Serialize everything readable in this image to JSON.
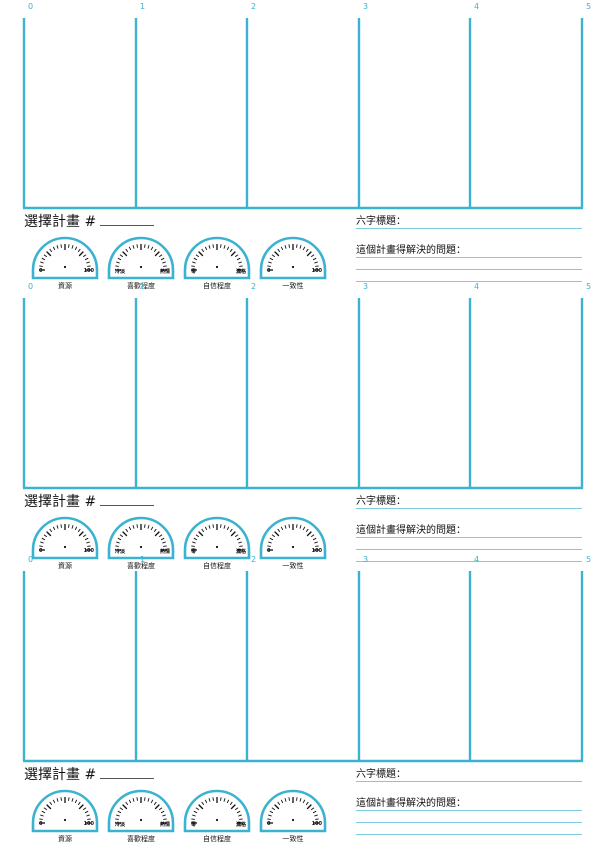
{
  "accent_color": "#3bb3d0",
  "axis_ticks": [
    "0",
    "1",
    "2",
    "3",
    "4",
    "5"
  ],
  "icons": {
    "gauge": "gauge-icon"
  },
  "blocks": [
    {
      "selection_label": "選擇計畫 #",
      "six_char_title_label": "六字標題：",
      "problem_label": "這個計畫得解決的問題：",
      "gauges": [
        {
          "caption": "資源",
          "low": "0",
          "high": "100"
        },
        {
          "caption": "喜歡程度",
          "low": "冷淡",
          "high": "熱情"
        },
        {
          "caption": "自信程度",
          "low": "零",
          "high": "滿格"
        },
        {
          "caption": "一致性",
          "low": "0",
          "high": "100"
        }
      ]
    },
    {
      "selection_label": "選擇計畫 #",
      "six_char_title_label": "六字標題：",
      "problem_label": "這個計畫得解決的問題：",
      "gauges": [
        {
          "caption": "資源",
          "low": "0",
          "high": "100"
        },
        {
          "caption": "喜歡程度",
          "low": "冷淡",
          "high": "熱情"
        },
        {
          "caption": "自信程度",
          "low": "零",
          "high": "滿格"
        },
        {
          "caption": "一致性",
          "low": "0",
          "high": "100"
        }
      ]
    },
    {
      "selection_label": "選擇計畫 #",
      "six_char_title_label": "六字標題：",
      "problem_label": "這個計畫得解決的問題：",
      "gauges": [
        {
          "caption": "資源",
          "low": "0",
          "high": "100"
        },
        {
          "caption": "喜歡程度",
          "low": "冷淡",
          "high": "熱情"
        },
        {
          "caption": "自信程度",
          "low": "零",
          "high": "滿格"
        },
        {
          "caption": "一致性",
          "low": "0",
          "high": "100"
        }
      ]
    }
  ]
}
